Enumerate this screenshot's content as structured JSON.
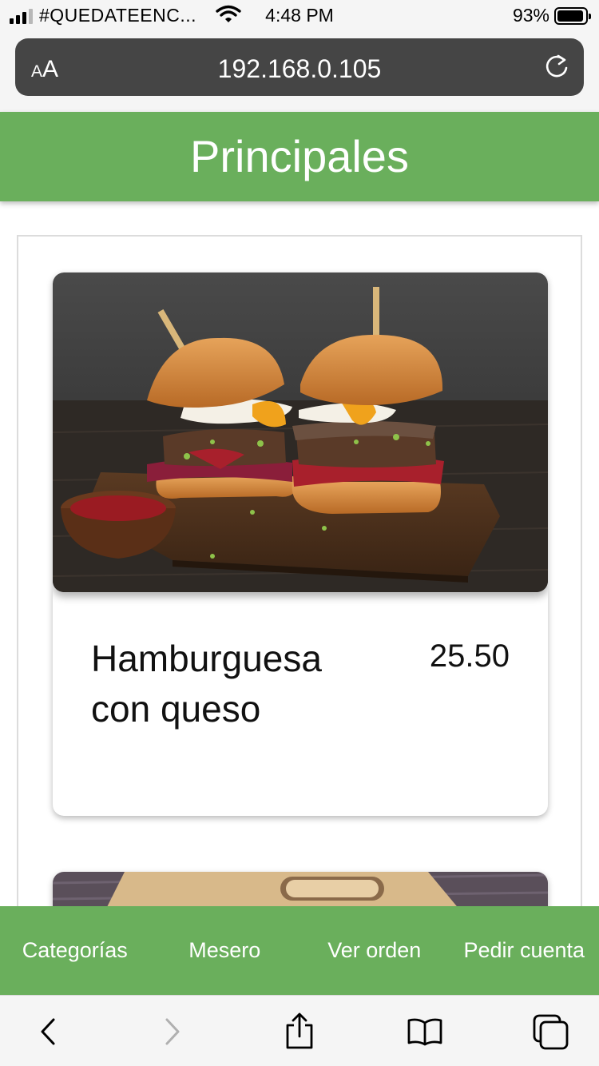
{
  "status_bar": {
    "carrier": "#QUEDATEENC...",
    "time": "4:48 PM",
    "battery_percent": "93%",
    "battery_level": 0.93
  },
  "browser": {
    "text_size_label_small": "A",
    "text_size_label_large": "A",
    "url": "192.168.0.105"
  },
  "header": {
    "title": "Principales"
  },
  "menu_items": [
    {
      "name": "Hamburguesa con queso",
      "price": "25.50"
    }
  ],
  "bottom_nav": {
    "items": [
      {
        "label": "Categorías"
      },
      {
        "label": "Mesero"
      },
      {
        "label": "Ver orden"
      },
      {
        "label": "Pedir cuenta"
      }
    ]
  },
  "colors": {
    "accent": "#6aaf5c",
    "address_bar": "#454545",
    "chrome": "#f5f5f5"
  },
  "icons": {
    "back": "chevron-left-icon",
    "forward": "chevron-right-icon",
    "share": "share-icon",
    "bookmarks": "book-icon",
    "tabs": "tabs-icon",
    "reload": "reload-icon",
    "wifi": "wifi-icon"
  }
}
